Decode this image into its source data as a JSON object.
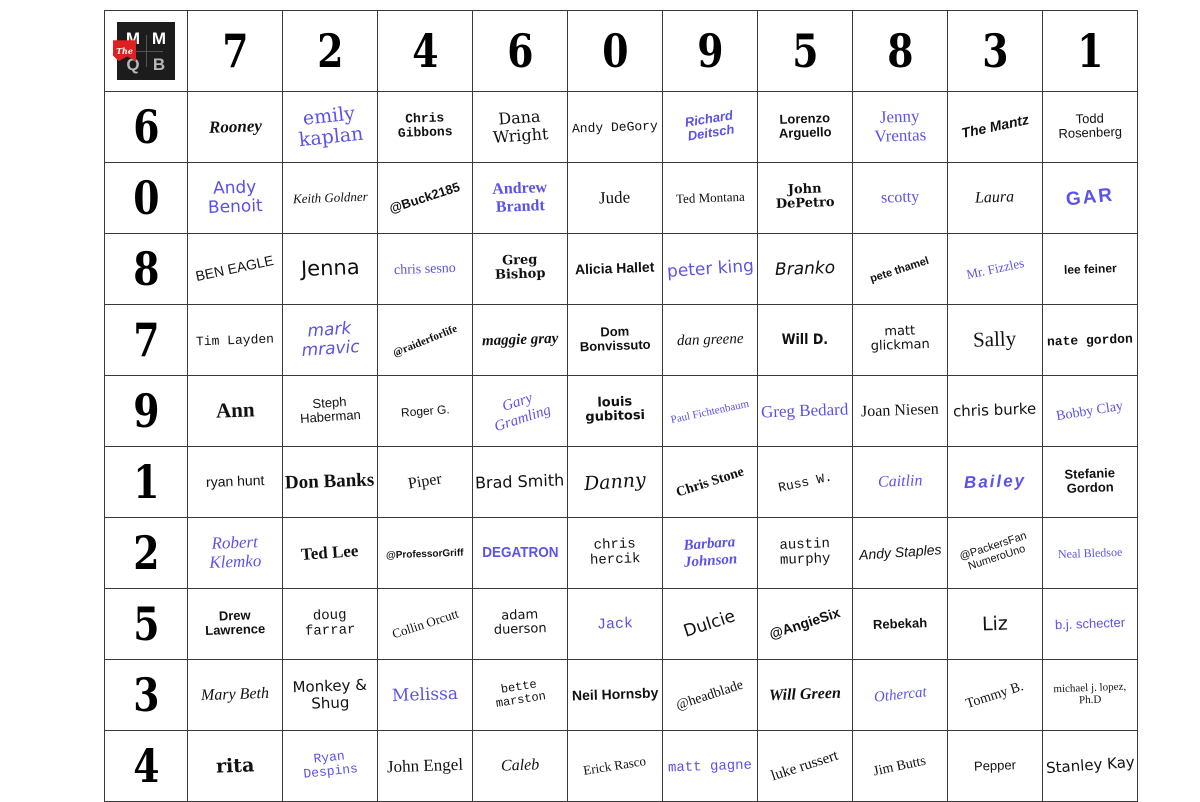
{
  "logo": {
    "name": "the-mmqb-logo",
    "ribbon_text": "The",
    "letters": [
      "M",
      "M",
      "Q",
      "B"
    ],
    "box_color": "#1c1c1c",
    "ribbon_color": "#e02020"
  },
  "colors": {
    "black": "#111111",
    "blue": "#5b52ec",
    "grid_line": "#3a3a3a",
    "background": "#ffffff"
  },
  "grid": {
    "column_headers": [
      "7",
      "2",
      "4",
      "6",
      "0",
      "9",
      "5",
      "8",
      "3",
      "1"
    ],
    "row_headers": [
      "6",
      "0",
      "8",
      "7",
      "9",
      "1",
      "2",
      "5",
      "3",
      "4"
    ],
    "rows": [
      [
        {
          "text": "Rooney",
          "color": "black",
          "font": "f-serif-bi",
          "size": "s-17",
          "rot": "r-n2"
        },
        {
          "text": "emily kaplan",
          "color": "blue",
          "font": "f-dserif",
          "size": "s-19",
          "rot": "r-n6"
        },
        {
          "text": "Chris Gibbons",
          "color": "black",
          "font": "f-mono-b",
          "size": "s-13",
          "rot": "r-n2"
        },
        {
          "text": "Dana Wright",
          "color": "black",
          "font": "f-dserif",
          "size": "s-16",
          "rot": "r-n4"
        },
        {
          "text": "Andy DeGory",
          "color": "black",
          "font": "f-mono",
          "size": "s-13",
          "rot": "r-n2"
        },
        {
          "text": "Richard Deitsch",
          "color": "blue",
          "font": "f-sans-bi",
          "size": "s-13",
          "rot": "r-n9"
        },
        {
          "text": "Lorenzo Arguello",
          "color": "black",
          "font": "f-sans-b",
          "size": "s-13",
          "rot": "r-n2"
        },
        {
          "text": "Jenny Vrentas",
          "color": "blue",
          "font": "f-serif",
          "size": "s-17",
          "rot": "r-n2"
        },
        {
          "text": "The Mantz",
          "color": "black",
          "font": "f-sans-bi",
          "size": "s-14",
          "rot": "r-n12"
        },
        {
          "text": "Todd Rosenberg",
          "color": "black",
          "font": "f-sans",
          "size": "s-13",
          "rot": "r-n2"
        }
      ],
      [
        {
          "text": "Andy Benoit",
          "color": "blue",
          "font": "f-dsans",
          "size": "s-17",
          "rot": "r-n2"
        },
        {
          "text": "Keith Goldner",
          "color": "black",
          "font": "f-serif-i",
          "size": "s-13",
          "rot": "r-n2"
        },
        {
          "text": "@Buck2185",
          "color": "black",
          "font": "f-sans-b",
          "size": "s-13",
          "rot": "r-n18"
        },
        {
          "text": "Andrew Brandt",
          "color": "blue",
          "font": "f-serif-b",
          "size": "s-16",
          "rot": "r-n2"
        },
        {
          "text": "Jude",
          "color": "black",
          "font": "f-serif",
          "size": "s-17",
          "rot": "r-n2"
        },
        {
          "text": "Ted Montana",
          "color": "black",
          "font": "f-serif",
          "size": "s-13",
          "rot": "r-n2"
        },
        {
          "text": "John DePetro",
          "color": "black",
          "font": "f-dserif-b",
          "size": "s-13",
          "rot": "r-n2"
        },
        {
          "text": "scotty",
          "color": "blue",
          "font": "f-serif",
          "size": "s-16",
          "rot": "r-n2"
        },
        {
          "text": "Laura",
          "color": "black",
          "font": "f-serif-i",
          "size": "s-16",
          "rot": "r-n2"
        },
        {
          "text": "GAR",
          "color": "blue",
          "font": "f-sans-b",
          "size": "s-19",
          "rot": "r-n6",
          "wide": true
        }
      ],
      [
        {
          "text": "BEN EAGLE",
          "color": "black",
          "font": "f-sans",
          "size": "s-14",
          "rot": "r-n12"
        },
        {
          "text": "Jenna",
          "color": "black",
          "font": "f-dsans",
          "size": "s-21",
          "rot": "r-n2"
        },
        {
          "text": "chris sesno",
          "color": "blue",
          "font": "f-serif",
          "size": "s-14",
          "rot": "r-n2"
        },
        {
          "text": "Greg Bishop",
          "color": "black",
          "font": "f-dserif-b",
          "size": "s-13",
          "rot": "r-n2"
        },
        {
          "text": "Alicia Hallet",
          "color": "black",
          "font": "f-sans-b",
          "size": "s-14",
          "rot": "r-n2"
        },
        {
          "text": "peter king",
          "color": "blue",
          "font": "f-dsans",
          "size": "s-17",
          "rot": "r-n4"
        },
        {
          "text": "Branko",
          "color": "black",
          "font": "f-dsans-i",
          "size": "s-17",
          "rot": "r-n2"
        },
        {
          "text": "pete thamel",
          "color": "black",
          "font": "f-sans-b",
          "size": "s-11",
          "rot": "r-n18"
        },
        {
          "text": "Mr. Fizzles",
          "color": "blue",
          "font": "f-serif",
          "size": "s-13",
          "rot": "r-n12"
        },
        {
          "text": "lee feiner",
          "color": "black",
          "font": "f-sans-b",
          "size": "s-12",
          "rot": "r-n2"
        }
      ],
      [
        {
          "text": "Tim Layden",
          "color": "black",
          "font": "f-mono",
          "size": "s-13",
          "rot": "r-n2"
        },
        {
          "text": "mark mravic",
          "color": "blue",
          "font": "f-dsans-i",
          "size": "s-17",
          "rot": "r-n4"
        },
        {
          "text": "@raiderforlife",
          "color": "black",
          "font": "f-serif-b",
          "size": "s-11",
          "rot": "r-n22"
        },
        {
          "text": "maggie gray",
          "color": "black",
          "font": "f-serif-bi",
          "size": "s-15",
          "rot": "r-n2"
        },
        {
          "text": "Dom Bonvissuto",
          "color": "black",
          "font": "f-sans-b",
          "size": "s-13",
          "rot": "r-n2"
        },
        {
          "text": "dan greene",
          "color": "black",
          "font": "f-serif-i",
          "size": "s-15",
          "rot": "r-n2"
        },
        {
          "text": "Will D.",
          "color": "black",
          "font": "f-dsans-b",
          "size": "s-14",
          "rot": "r-n12",
          "cond": true
        },
        {
          "text": "matt glickman",
          "color": "black",
          "font": "f-dsans",
          "size": "s-13",
          "rot": "r-n2"
        },
        {
          "text": "Sally",
          "color": "black",
          "font": "f-serif",
          "size": "s-21",
          "rot": "r-n2"
        },
        {
          "text": "nate gordon",
          "color": "black",
          "font": "f-mono-b",
          "size": "s-13",
          "rot": "r-n2"
        }
      ],
      [
        {
          "text": "Ann",
          "color": "black",
          "font": "f-serif-b",
          "size": "s-21",
          "rot": "r-n2"
        },
        {
          "text": "Steph Haberman",
          "color": "black",
          "font": "f-sans",
          "size": "s-13",
          "rot": "r-n4"
        },
        {
          "text": "Roger G.",
          "color": "black",
          "font": "f-sans",
          "size": "s-12",
          "rot": "r-n4"
        },
        {
          "text": "Gary Gramling",
          "color": "blue",
          "font": "f-serif-i",
          "size": "s-15",
          "rot": "r-n18"
        },
        {
          "text": "louis gubitosi",
          "color": "black",
          "font": "f-dsans-b",
          "size": "s-13",
          "rot": "r-n2"
        },
        {
          "text": "Paul Fichtenbaum",
          "color": "blue",
          "font": "f-serif",
          "size": "s-11",
          "rot": "r-n12"
        },
        {
          "text": "Greg Bedard",
          "color": "blue",
          "font": "f-serif",
          "size": "s-17",
          "rot": "r-n2"
        },
        {
          "text": "Joan Niesen",
          "color": "black",
          "font": "f-serif",
          "size": "s-16",
          "rot": "r-n2"
        },
        {
          "text": "chris burke",
          "color": "black",
          "font": "f-dsans",
          "size": "s-15",
          "rot": "r-n2"
        },
        {
          "text": "Bobby Clay",
          "color": "blue",
          "font": "f-serif",
          "size": "s-14",
          "rot": "r-n9"
        }
      ],
      [
        {
          "text": "ryan hunt",
          "color": "black",
          "font": "f-sans",
          "size": "s-14",
          "rot": "r-n2"
        },
        {
          "text": "Don Banks",
          "color": "black",
          "font": "f-serif-b",
          "size": "s-19",
          "rot": "r-n2"
        },
        {
          "text": "Piper",
          "color": "black",
          "font": "f-serif",
          "size": "s-16",
          "rot": "r-n9"
        },
        {
          "text": "Brad Smith",
          "color": "black",
          "font": "f-dsans",
          "size": "s-16",
          "rot": "r-n2"
        },
        {
          "text": "Danny",
          "color": "black",
          "font": "f-dserif-i",
          "size": "s-19",
          "rot": "r-n4"
        },
        {
          "text": "Chris Stone",
          "color": "black",
          "font": "f-serif-b",
          "size": "s-14",
          "rot": "r-n18"
        },
        {
          "text": "Russ W.",
          "color": "black",
          "font": "f-mono",
          "size": "s-13",
          "rot": "r-n12"
        },
        {
          "text": "Caitlin",
          "color": "blue",
          "font": "f-serif-i",
          "size": "s-16",
          "rot": "r-n2"
        },
        {
          "text": "Bailey",
          "color": "blue",
          "font": "f-sans-bi",
          "size": "s-17",
          "rot": "r-n2",
          "wide": true
        },
        {
          "text": "Stefanie Gordon",
          "color": "black",
          "font": "f-sans-b",
          "size": "s-13",
          "rot": "r-n2"
        }
      ],
      [
        {
          "text": "Robert Klemko",
          "color": "blue",
          "font": "f-serif-i",
          "size": "s-17",
          "rot": "r-n2"
        },
        {
          "text": "Ted Lee",
          "color": "black",
          "font": "f-serif-b",
          "size": "s-17",
          "rot": "r-n4"
        },
        {
          "text": "@ProfessorGriff",
          "color": "black",
          "font": "f-sans-b",
          "size": "s-10",
          "rot": "r-n2"
        },
        {
          "text": "DEGATRON",
          "color": "blue",
          "font": "f-sans-b",
          "size": "s-15",
          "rot": "r-n18",
          "cond": true
        },
        {
          "text": "chris hercik",
          "color": "black",
          "font": "f-mono",
          "size": "s-14",
          "rot": "r-n2"
        },
        {
          "text": "Barbara Johnson",
          "color": "blue",
          "font": "f-serif-bi",
          "size": "s-15",
          "rot": "r-n4"
        },
        {
          "text": "austin murphy",
          "color": "black",
          "font": "f-mono",
          "size": "s-14",
          "rot": "r-n2"
        },
        {
          "text": "Andy Staples",
          "color": "black",
          "font": "f-sans-i",
          "size": "s-14",
          "rot": "r-n4"
        },
        {
          "text": "@PackersFan NumeroUno",
          "color": "black",
          "font": "f-sans",
          "size": "s-11",
          "rot": "r-n18"
        },
        {
          "text": "Neal Bledsoe",
          "color": "blue",
          "font": "f-serif",
          "size": "s-12",
          "rot": "r-n2"
        }
      ],
      [
        {
          "text": "Drew Lawrence",
          "color": "black",
          "font": "f-sans-b",
          "size": "s-13",
          "rot": "r-n2"
        },
        {
          "text": "doug farrar",
          "color": "black",
          "font": "f-mono",
          "size": "s-14",
          "rot": "r-n2"
        },
        {
          "text": "Collin Orcutt",
          "color": "black",
          "font": "f-serif",
          "size": "s-13",
          "rot": "r-n18"
        },
        {
          "text": "adam duerson",
          "color": "black",
          "font": "f-dsans",
          "size": "s-13",
          "rot": "r-n2"
        },
        {
          "text": "Jack",
          "color": "blue",
          "font": "f-mono",
          "size": "s-15",
          "rot": "r-n2"
        },
        {
          "text": "Dulcie",
          "color": "black",
          "font": "f-dsans",
          "size": "s-17",
          "rot": "r-n18"
        },
        {
          "text": "@AngieSix",
          "color": "black",
          "font": "f-sans-b",
          "size": "s-14",
          "rot": "r-n18"
        },
        {
          "text": "Rebekah",
          "color": "black",
          "font": "f-sans-b",
          "size": "s-13",
          "rot": "r-n2"
        },
        {
          "text": "Liz",
          "color": "black",
          "font": "f-dsans",
          "size": "s-19",
          "rot": "r-n2"
        },
        {
          "text": "b.j. schecter",
          "color": "blue",
          "font": "f-sans",
          "size": "s-13",
          "rot": "r-n2"
        }
      ],
      [
        {
          "text": "Mary Beth",
          "color": "black",
          "font": "f-serif-i",
          "size": "s-16",
          "rot": "r-n2"
        },
        {
          "text": "Monkey & Shug",
          "color": "black",
          "font": "f-dsans",
          "size": "s-15",
          "rot": "r-n2"
        },
        {
          "text": "Melissa",
          "color": "blue",
          "font": "f-dserif",
          "size": "s-17",
          "rot": "r-n2"
        },
        {
          "text": "bette marston",
          "color": "black",
          "font": "f-mono",
          "size": "s-12",
          "rot": "r-n9"
        },
        {
          "text": "Neil Hornsby",
          "color": "black",
          "font": "f-sans-b",
          "size": "s-14",
          "rot": "r-n2"
        },
        {
          "text": "@headblade",
          "color": "black",
          "font": "f-serif",
          "size": "s-14",
          "rot": "r-n18"
        },
        {
          "text": "Will Green",
          "color": "black",
          "font": "f-serif-bi",
          "size": "s-16",
          "rot": "r-n2"
        },
        {
          "text": "Othercat",
          "color": "blue",
          "font": "f-serif-i",
          "size": "s-15",
          "rot": "r-n6"
        },
        {
          "text": "Tommy B.",
          "color": "black",
          "font": "f-serif",
          "size": "s-14",
          "rot": "r-n18"
        },
        {
          "text": "michael j. lopez, Ph.D",
          "color": "black",
          "font": "f-serif",
          "size": "s-11",
          "rot": "r-n2"
        }
      ],
      [
        {
          "text": "rita",
          "color": "black",
          "font": "f-dserif-b",
          "size": "s-19",
          "rot": "r-n2"
        },
        {
          "text": "Ryan Despins",
          "color": "blue",
          "font": "f-mono",
          "size": "s-13",
          "rot": "r-n6"
        },
        {
          "text": "John Engel",
          "color": "black",
          "font": "f-serif",
          "size": "s-17",
          "rot": "r-n2"
        },
        {
          "text": "Caleb",
          "color": "black",
          "font": "f-serif-i",
          "size": "s-16",
          "rot": "r-n2"
        },
        {
          "text": "Erick Rasco",
          "color": "black",
          "font": "f-serif",
          "size": "s-13",
          "rot": "r-n9"
        },
        {
          "text": "matt gagne",
          "color": "blue",
          "font": "f-mono",
          "size": "s-14",
          "rot": "r-n2"
        },
        {
          "text": "luke russert",
          "color": "black",
          "font": "f-serif",
          "size": "s-15",
          "rot": "r-n18"
        },
        {
          "text": "Jim Butts",
          "color": "black",
          "font": "f-serif",
          "size": "s-14",
          "rot": "r-n12"
        },
        {
          "text": "Pepper",
          "color": "black",
          "font": "f-sans",
          "size": "s-13",
          "rot": "r-n2"
        },
        {
          "text": "Stanley Kay",
          "color": "black",
          "font": "f-dsans",
          "size": "s-15",
          "rot": "r-n4"
        }
      ]
    ]
  }
}
